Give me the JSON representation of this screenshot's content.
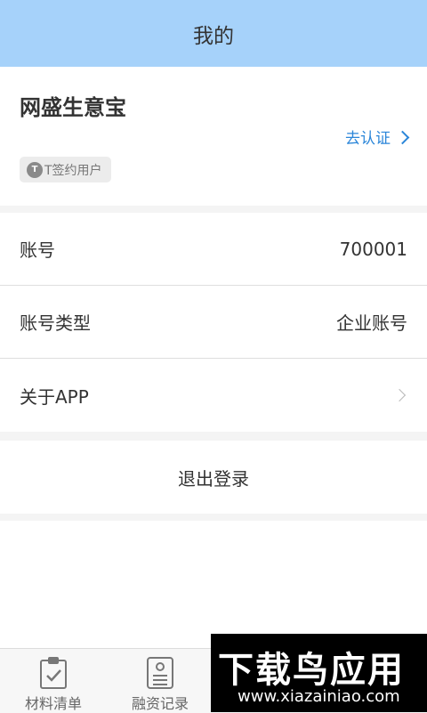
{
  "header": {
    "title": "我的"
  },
  "profile": {
    "company_name": "网盛生意宝",
    "verify_link": "去认证",
    "tag": {
      "badge": "T",
      "label": "T签约用户"
    }
  },
  "info_rows": [
    {
      "label": "账号",
      "value": "700001"
    },
    {
      "label": "账号类型",
      "value": "企业账号"
    },
    {
      "label": "关于APP",
      "value": ""
    }
  ],
  "logout_label": "退出登录",
  "tabs": [
    {
      "label": "材料清单",
      "icon": "clipboard-check-icon"
    },
    {
      "label": "融资记录",
      "icon": "id-card-icon"
    }
  ],
  "watermark": {
    "title": "下载鸟应用",
    "url": "www.xiazainiao.com"
  },
  "colors": {
    "header_bg": "#a6d2fa",
    "link": "#2b86d9"
  }
}
